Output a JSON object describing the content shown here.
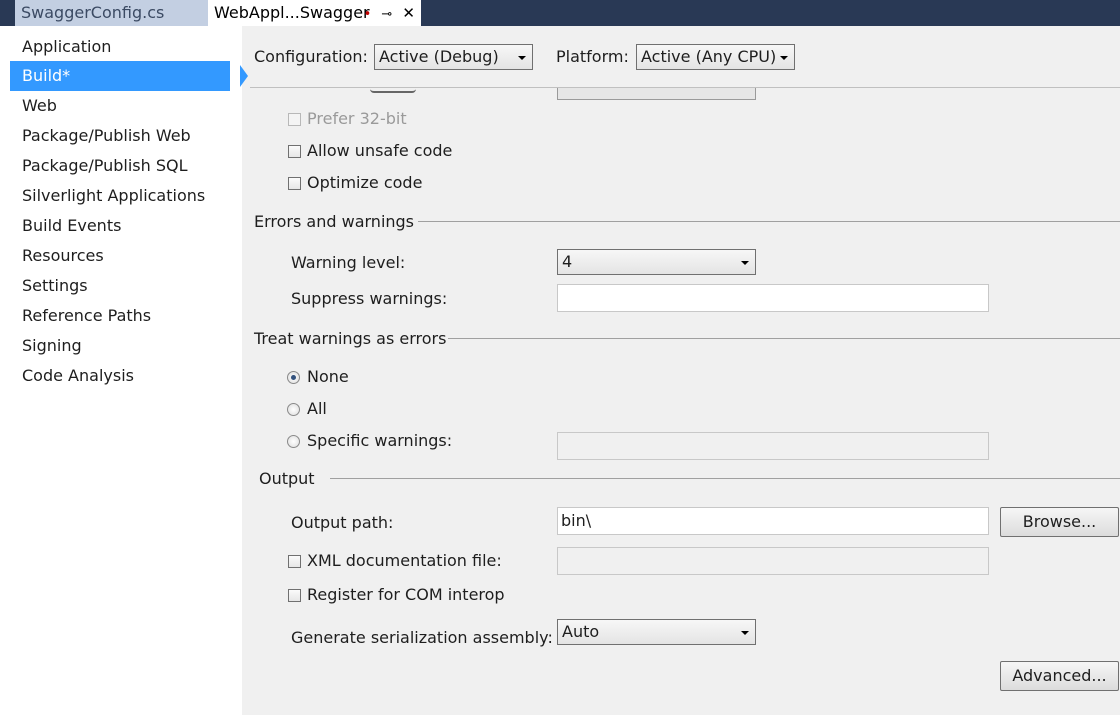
{
  "tabs": [
    {
      "label": "SwaggerConfig.cs",
      "active": false
    },
    {
      "label": "WebAppl...Swagger",
      "active": true,
      "pin_icon": "pin-icon",
      "close_icon": "close-icon"
    }
  ],
  "sidebar": {
    "items": [
      {
        "label": "Application"
      },
      {
        "label": "Build*",
        "selected": true
      },
      {
        "label": "Web"
      },
      {
        "label": "Package/Publish Web"
      },
      {
        "label": "Package/Publish SQL"
      },
      {
        "label": "Silverlight Applications"
      },
      {
        "label": "Build Events"
      },
      {
        "label": "Resources"
      },
      {
        "label": "Settings"
      },
      {
        "label": "Reference Paths"
      },
      {
        "label": "Signing"
      },
      {
        "label": "Code Analysis"
      }
    ],
    "accent": "#3399ff"
  },
  "header": {
    "configuration_label": "Configuration:",
    "configuration_value": "Active (Debug)",
    "platform_label": "Platform:",
    "platform_value": "Active (Any CPU)"
  },
  "general": {
    "prefer32_label": "Prefer 32-bit",
    "allow_unsafe_label": "Allow unsafe code",
    "optimize_label": "Optimize code"
  },
  "errors": {
    "section_title": "Errors and warnings",
    "warning_level_label": "Warning level:",
    "warning_level_value": "4",
    "suppress_label": "Suppress warnings:",
    "suppress_value": ""
  },
  "treat_warnings": {
    "section_title": "Treat warnings as errors",
    "none_label": "None",
    "all_label": "All",
    "specific_label": "Specific warnings:",
    "specific_value": "",
    "selected": "None"
  },
  "output": {
    "section_title": "Output",
    "path_label": "Output path:",
    "path_value": "bin\\",
    "browse_label": "Browse...",
    "xml_doc_label": "XML documentation file:",
    "xml_doc_value": "",
    "com_interop_label": "Register for COM interop",
    "serialization_label": "Generate serialization assembly:",
    "serialization_value": "Auto",
    "advanced_label": "Advanced..."
  }
}
